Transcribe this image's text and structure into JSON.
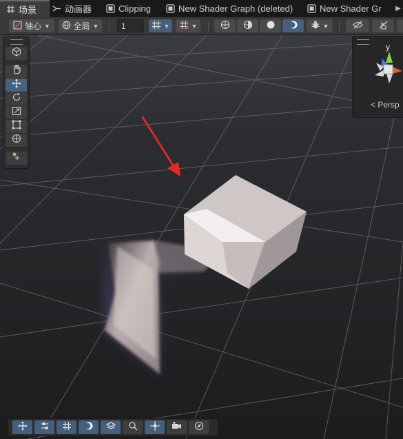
{
  "tabs": [
    {
      "label": "场景",
      "icon": "scene-grid-icon",
      "active": true
    },
    {
      "label": "动画器",
      "icon": "animator-icon",
      "active": false
    },
    {
      "label": "Clipping",
      "icon": "shader-graph-icon",
      "active": false
    },
    {
      "label": "New Shader Graph (deleted)",
      "icon": "shader-graph-icon",
      "active": false
    },
    {
      "label": "New Shader Gr",
      "icon": "shader-graph-icon",
      "active": false
    }
  ],
  "toolbar": {
    "pivot_label": "轴心",
    "global_label": "全局",
    "increment_value": "1"
  },
  "scene_view": {
    "projection_label": "< Persp",
    "gizmo_axis_label": "y"
  },
  "colors": {
    "selected_button": "#46607c",
    "arrow_annotation": "#e02a2a",
    "gizmo_y": "#8cd14e",
    "gizmo_x": "#e0593b",
    "gizmo_z": "#3d7be6"
  }
}
